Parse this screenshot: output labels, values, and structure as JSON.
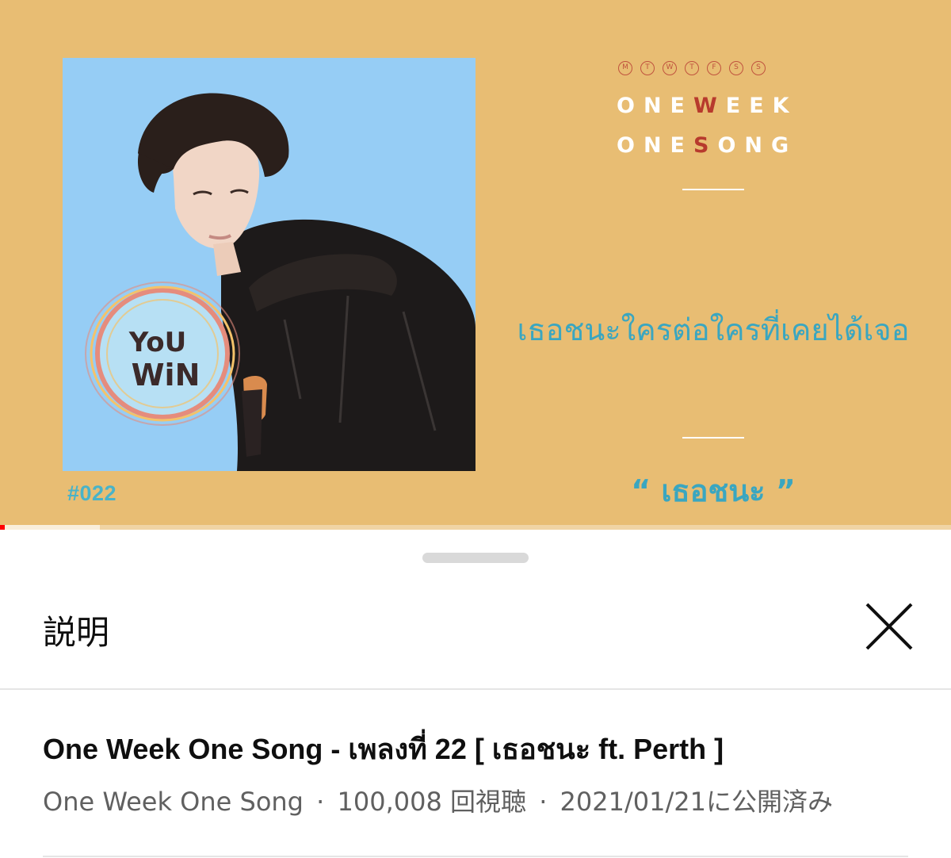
{
  "video": {
    "badge_number": "#022",
    "day_letters": [
      "M",
      "T",
      "W",
      "T",
      "F",
      "S",
      "S"
    ],
    "logo_line1": {
      "pre": "ONE",
      "accent": "W",
      "post": "EEK"
    },
    "logo_line2": {
      "pre": "ONE",
      "accent": "S",
      "post": "ONG"
    },
    "lyric": "เธอชนะใครต่อใครที่เคยได้เจอ",
    "song_title": "“ เธอชนะ ”",
    "art_text_line1": "YoU",
    "art_text_line2": "WiN",
    "progress_fraction": 0.005,
    "buffer_fraction": 0.105,
    "colors": {
      "background": "#e8bd73",
      "art_bg": "#96cdf5",
      "accent_red": "#b73a2d",
      "teal": "#3aa6c0",
      "progress": "#ff0000"
    }
  },
  "sheet": {
    "title": "説明",
    "close_icon": "close-icon",
    "video_title": "One Week One Song - เพลงที่ 22 [ เธอชนะ ft. Perth ]",
    "channel": "One Week One Song",
    "separator": "·",
    "views": "100,008 回視聴",
    "published": "2021/01/21に公開済み"
  }
}
